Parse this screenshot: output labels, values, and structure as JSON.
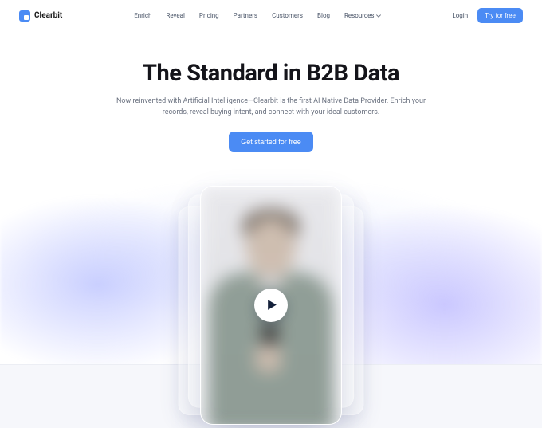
{
  "brand": {
    "name": "Clearbit"
  },
  "nav": {
    "items": [
      {
        "label": "Enrich"
      },
      {
        "label": "Reveal"
      },
      {
        "label": "Pricing"
      },
      {
        "label": "Partners"
      },
      {
        "label": "Customers"
      },
      {
        "label": "Blog"
      },
      {
        "label": "Resources",
        "has_dropdown": true
      }
    ]
  },
  "auth": {
    "login_label": "Login",
    "cta_label": "Try for free"
  },
  "hero": {
    "title": "The Standard in B2B Data",
    "subtitle": "Now reinvented with Artificial Intelligence—Clearbit is the first AI Native Data Provider. Enrich your records, reveal buying intent, and connect with your ideal customers.",
    "cta_label": "Get started for free"
  }
}
